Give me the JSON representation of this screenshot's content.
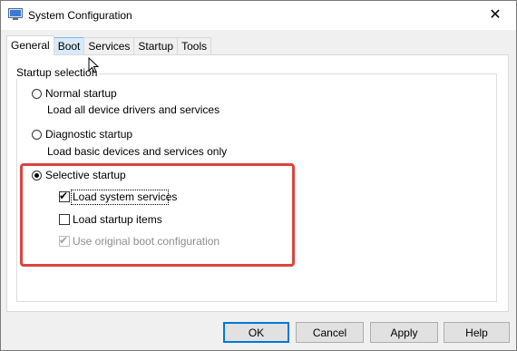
{
  "window": {
    "title": "System Configuration",
    "close_glyph": "✕"
  },
  "tabs": [
    {
      "label": "General",
      "active": true
    },
    {
      "label": "Boot",
      "active": false
    },
    {
      "label": "Services",
      "active": false
    },
    {
      "label": "Startup",
      "active": false
    },
    {
      "label": "Tools",
      "active": false
    }
  ],
  "startup_selection": {
    "group_label": "Startup selection",
    "normal": {
      "label": "Normal startup",
      "description": "Load all device drivers and services",
      "selected": false
    },
    "diagnostic": {
      "label": "Diagnostic startup",
      "description": "Load basic devices and services only",
      "selected": false
    },
    "selective": {
      "label": "Selective startup",
      "selected": true,
      "options": {
        "load_system_services": {
          "label": "Load system services",
          "checked": true,
          "enabled": true
        },
        "load_startup_items": {
          "label": "Load startup items",
          "checked": false,
          "enabled": true
        },
        "use_original_boot": {
          "label": "Use original boot configuration",
          "checked": true,
          "enabled": false
        }
      }
    }
  },
  "buttons": {
    "ok": "OK",
    "cancel": "Cancel",
    "apply": "Apply",
    "help": "Help"
  },
  "colors": {
    "highlight_border": "#d9443f",
    "default_button_border": "#0078d7"
  },
  "icons": {
    "app": "system-configuration-icon",
    "close": "close-icon",
    "cursor": "mouse-pointer-icon"
  }
}
